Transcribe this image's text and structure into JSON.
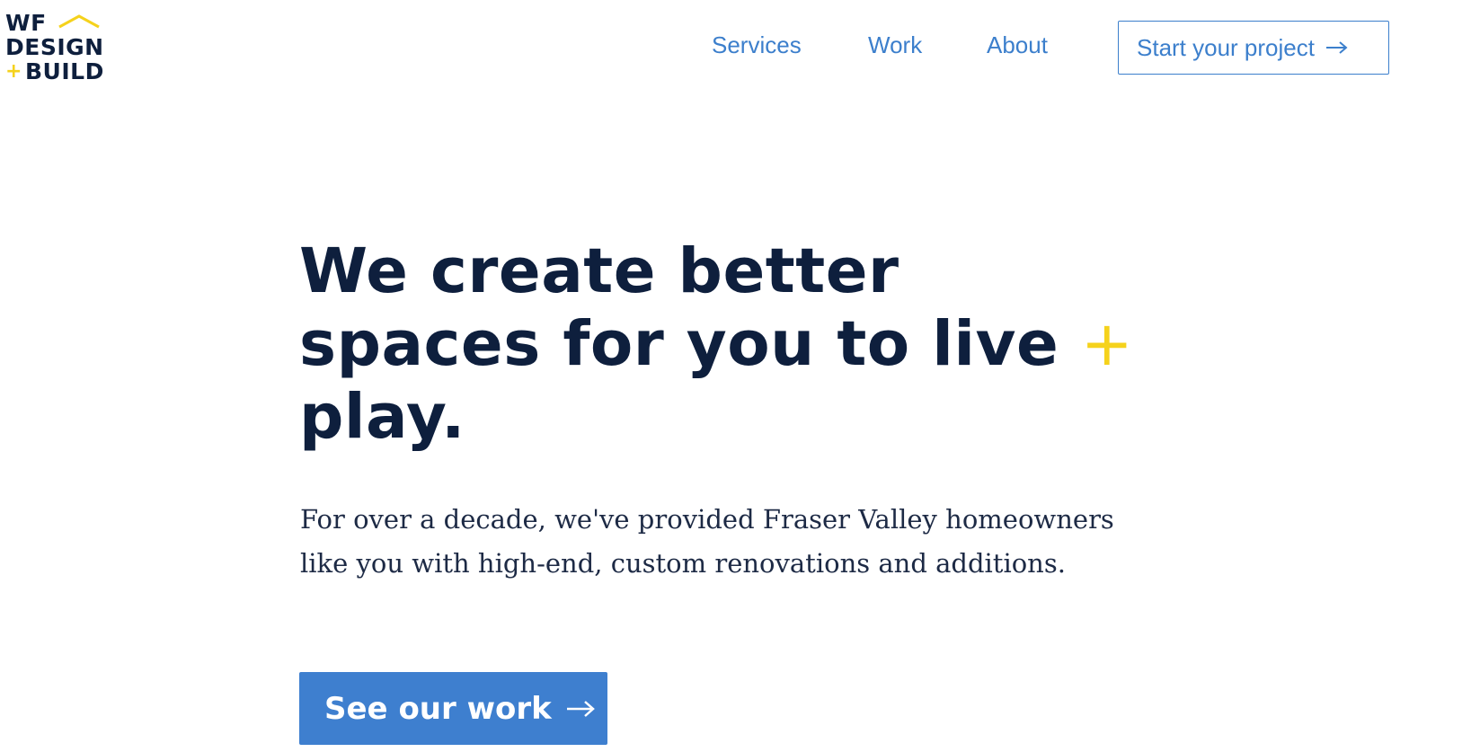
{
  "brand": {
    "logo_line1": "WF",
    "logo_line2": "DESIGN",
    "logo_plus": "+",
    "logo_line3": "BUILD",
    "primary_color": "#3c7fcc",
    "navy_color": "#0e1f3d",
    "accent_color": "#f5d21c"
  },
  "nav": {
    "items": [
      {
        "label": "Services"
      },
      {
        "label": "Work"
      },
      {
        "label": "About"
      }
    ],
    "cta_label": "Start your project",
    "cta_icon": "arrow-right-icon"
  },
  "hero": {
    "title_line1": "We create better",
    "title_line2": "spaces for you to live",
    "title_plus": "+",
    "title_line3": "play.",
    "text_line1": "For over a decade, we've provided Fraser Valley homeowners",
    "text_line2": "like you with high-end, custom renovations and additions.",
    "button_label": "See our work",
    "button_icon": "arrow-right-icon"
  }
}
